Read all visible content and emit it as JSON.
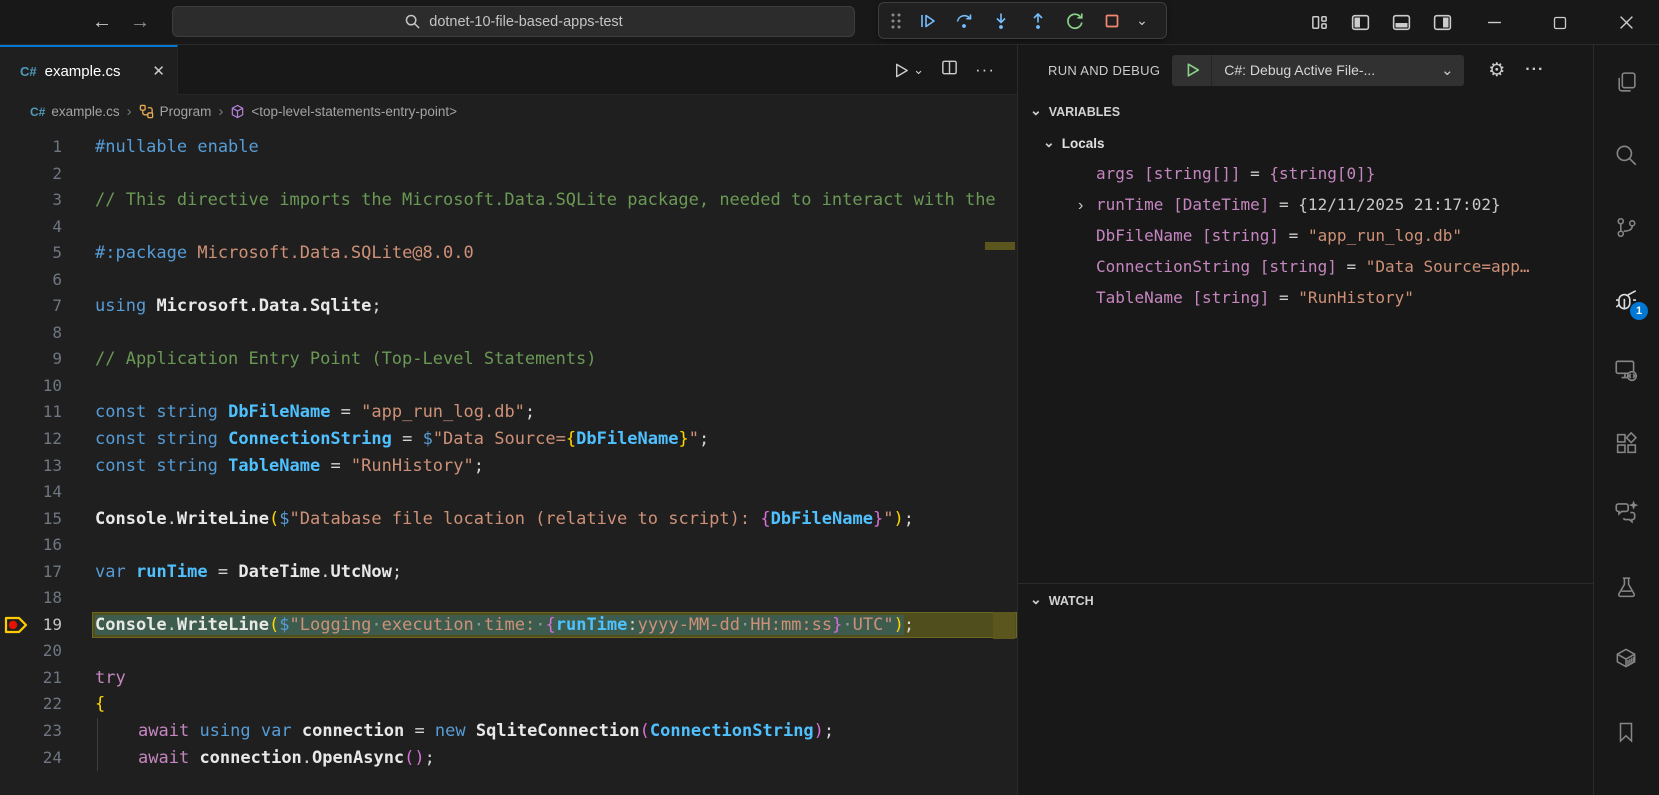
{
  "icons": {
    "back": "←",
    "forward": "→",
    "search": "search-glyph",
    "chevron-down": "⌄",
    "chevron-right-twisty": "›",
    "more-horizontal": "⋯",
    "close": "✕",
    "gear": "⚙",
    "csharp": "C#",
    "breadcrumb-separator": "›"
  },
  "titlebar": {
    "command_center": {
      "value": "dotnet-10-file-based-apps-test"
    },
    "debug_toolbar_buttons": [
      "drag-handle",
      "continue",
      "step-over",
      "step-into",
      "step-out",
      "restart",
      "stop",
      "dropdown"
    ],
    "layout_buttons": [
      "customize-layout",
      "toggle-primary-sidebar",
      "toggle-panel",
      "toggle-secondary-sidebar"
    ],
    "window_buttons": [
      "minimize",
      "maximize",
      "close"
    ]
  },
  "editor": {
    "tab": {
      "label": "example.cs"
    },
    "breadcrumbs": [
      {
        "icon": "csharp-file-icon",
        "label": "example.cs"
      },
      {
        "icon": "symbol-class-icon",
        "label": "Program"
      },
      {
        "icon": "symbol-namespace-icon",
        "label": "<top-level-statements-entry-point>"
      }
    ],
    "lines": [
      {
        "n": 1,
        "tokens": [
          [
            "kw",
            "#nullable enable"
          ]
        ]
      },
      {
        "n": 2,
        "tokens": []
      },
      {
        "n": 3,
        "tokens": [
          [
            "cmt",
            "// This directive imports the Microsoft.Data.SQLite package, needed to interact with the"
          ]
        ]
      },
      {
        "n": 4,
        "tokens": []
      },
      {
        "n": 5,
        "tokens": [
          [
            "kw",
            "#:package"
          ],
          [
            "pn",
            " "
          ],
          [
            "str",
            "Microsoft.Data.SQLite@8.0.0"
          ]
        ]
      },
      {
        "n": 6,
        "tokens": []
      },
      {
        "n": 7,
        "tokens": [
          [
            "kw",
            "using"
          ],
          [
            "pn",
            " "
          ],
          [
            "idb",
            "Microsoft.Data.Sqlite"
          ],
          [
            "pn",
            ";"
          ]
        ]
      },
      {
        "n": 8,
        "tokens": []
      },
      {
        "n": 9,
        "tokens": [
          [
            "cmt",
            "// Application Entry Point (Top-Level Statements)"
          ]
        ]
      },
      {
        "n": 10,
        "tokens": []
      },
      {
        "n": 11,
        "tokens": [
          [
            "kw",
            "const string"
          ],
          [
            "pn",
            " "
          ],
          [
            "var",
            "DbFileName"
          ],
          [
            "pn",
            " = "
          ],
          [
            "str",
            "\"app_run_log.db\""
          ],
          [
            "pn",
            ";"
          ]
        ]
      },
      {
        "n": 12,
        "tokens": [
          [
            "kw",
            "const string"
          ],
          [
            "pn",
            " "
          ],
          [
            "var",
            "ConnectionString"
          ],
          [
            "pn",
            " = "
          ],
          [
            "kw",
            "$"
          ],
          [
            "str",
            "\"Data Source="
          ],
          [
            "b1",
            "{"
          ],
          [
            "var",
            "DbFileName"
          ],
          [
            "b1",
            "}"
          ],
          [
            "str",
            "\""
          ],
          [
            "pn",
            ";"
          ]
        ]
      },
      {
        "n": 13,
        "tokens": [
          [
            "kw",
            "const string"
          ],
          [
            "pn",
            " "
          ],
          [
            "var",
            "TableName"
          ],
          [
            "pn",
            " = "
          ],
          [
            "str",
            "\"RunHistory\""
          ],
          [
            "pn",
            ";"
          ]
        ]
      },
      {
        "n": 14,
        "tokens": []
      },
      {
        "n": 15,
        "tokens": [
          [
            "idb",
            "Console"
          ],
          [
            "pn",
            "."
          ],
          [
            "idb",
            "WriteLine"
          ],
          [
            "b1",
            "("
          ],
          [
            "kw",
            "$"
          ],
          [
            "str",
            "\"Database file location (relative to script): "
          ],
          [
            "b2",
            "{"
          ],
          [
            "var",
            "DbFileName"
          ],
          [
            "b2",
            "}"
          ],
          [
            "str",
            "\""
          ],
          [
            "b1",
            ")"
          ],
          [
            "pn",
            ";"
          ]
        ]
      },
      {
        "n": 16,
        "tokens": []
      },
      {
        "n": 17,
        "tokens": [
          [
            "kw",
            "var"
          ],
          [
            "pn",
            " "
          ],
          [
            "var",
            "runTime"
          ],
          [
            "pn",
            " = "
          ],
          [
            "idb",
            "DateTime"
          ],
          [
            "pn",
            "."
          ],
          [
            "idb",
            "UtcNow"
          ],
          [
            "pn",
            ";"
          ]
        ]
      },
      {
        "n": 18,
        "tokens": []
      },
      {
        "n": 19,
        "current": true,
        "breakpoint": true,
        "tokens": [
          [
            "idb",
            "Console",
            1
          ],
          [
            "pn",
            ".",
            1
          ],
          [
            "idb",
            "WriteLine",
            1
          ],
          [
            "b1",
            "(",
            1
          ],
          [
            "kw",
            "$",
            1
          ],
          [
            "str",
            "\"Logging",
            1
          ],
          [
            "wsd",
            "·",
            1
          ],
          [
            "str",
            "execution",
            1
          ],
          [
            "wsd",
            "·",
            1
          ],
          [
            "str",
            "time:",
            1
          ],
          [
            "wsd",
            "·",
            1
          ],
          [
            "b2",
            "{",
            1
          ],
          [
            "var",
            "runTime",
            1
          ],
          [
            "pn",
            ":",
            1
          ],
          [
            "str",
            "yyyy-MM-dd",
            1
          ],
          [
            "wsd",
            "·",
            1
          ],
          [
            "str",
            "HH:mm:ss",
            1
          ],
          [
            "b2",
            "}",
            1
          ],
          [
            "wsd",
            "·",
            1
          ],
          [
            "str",
            "UTC\"",
            1
          ],
          [
            "b1",
            ")",
            1
          ],
          [
            "pn",
            ";"
          ]
        ]
      },
      {
        "n": 20,
        "tokens": []
      },
      {
        "n": 21,
        "tokens": [
          [
            "ctl",
            "try"
          ]
        ]
      },
      {
        "n": 22,
        "tokens": [
          [
            "b1",
            "{"
          ]
        ]
      },
      {
        "n": 23,
        "indent": 1,
        "tokens": [
          [
            "ctl",
            "await"
          ],
          [
            "pn",
            " "
          ],
          [
            "kw",
            "using"
          ],
          [
            "pn",
            " "
          ],
          [
            "kw",
            "var"
          ],
          [
            "pn",
            " "
          ],
          [
            "idb",
            "connection"
          ],
          [
            "pn",
            " = "
          ],
          [
            "kw",
            "new"
          ],
          [
            "pn",
            " "
          ],
          [
            "idb",
            "SqliteConnection"
          ],
          [
            "b2",
            "("
          ],
          [
            "var",
            "ConnectionString"
          ],
          [
            "b2",
            ")"
          ],
          [
            "pn",
            ";"
          ]
        ]
      },
      {
        "n": 24,
        "indent": 1,
        "tokens": [
          [
            "ctl",
            "await"
          ],
          [
            "pn",
            " "
          ],
          [
            "idb",
            "connection"
          ],
          [
            "pn",
            "."
          ],
          [
            "idb",
            "OpenAsync"
          ],
          [
            "b2",
            "("
          ],
          [
            "b2",
            ")"
          ],
          [
            "pn",
            ";"
          ]
        ]
      }
    ]
  },
  "run_panel": {
    "title": "RUN AND DEBUG",
    "launch_config": "C#: Debug Active File-...",
    "sections": {
      "variables": {
        "label": "VARIABLES",
        "scope": "Locals",
        "locals": [
          {
            "name": "args",
            "type": "[string[]]",
            "value": "{string[0]}",
            "value_class": "violet",
            "expandable": false
          },
          {
            "name": "runTime",
            "type": "[DateTime]",
            "value": "{12/11/2025 21:17:02}",
            "value_class": "plain",
            "expandable": true
          },
          {
            "name": "DbFileName",
            "type": "[string]",
            "value": "\"app_run_log.db\"",
            "value_class": "string",
            "expandable": false
          },
          {
            "name": "ConnectionString",
            "type": "[string]",
            "value": "\"Data Source=app…",
            "value_class": "string",
            "expandable": false
          },
          {
            "name": "TableName",
            "type": "[string]",
            "value": "\"RunHistory\"",
            "value_class": "string",
            "expandable": false
          }
        ]
      },
      "watch": {
        "label": "WATCH"
      }
    }
  },
  "activity_bar": {
    "badge": "1",
    "items": [
      "explorer",
      "search",
      "source-control",
      "run-and-debug",
      "remote-explorer",
      "extensions",
      "chat",
      "testing",
      "containers",
      "bookmarks"
    ]
  },
  "colors": {
    "accent": "#0078d4",
    "debug_blue": "#75beff",
    "debug_green": "#89d185",
    "debug_red": "#f48771",
    "current_line_bg": "#514e1d",
    "selection_bg": "#3d5c4d"
  }
}
